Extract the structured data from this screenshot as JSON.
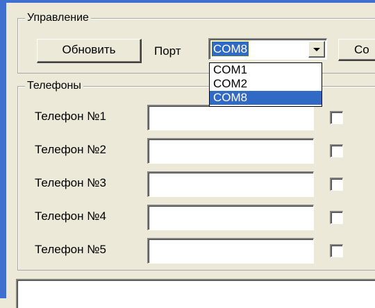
{
  "control_group": {
    "legend": "Управление",
    "refresh_button": "Обновить",
    "port_label": "Порт",
    "port_value": "COM8",
    "connect_button_partial": "Co",
    "port_options": [
      "COM1",
      "COM2",
      "COM8"
    ],
    "selected_option": "COM8"
  },
  "phones_group": {
    "legend": "Телефоны",
    "rows": [
      {
        "label": "Телефон №1",
        "value": ""
      },
      {
        "label": "Телефон №2",
        "value": ""
      },
      {
        "label": "Телефон №3",
        "value": ""
      },
      {
        "label": "Телефон №4",
        "value": ""
      },
      {
        "label": "Телефон №5",
        "value": ""
      }
    ]
  },
  "colors": {
    "window_blue": "#3f6fcf",
    "selection_blue": "#316ac5",
    "face": "#ece9d8"
  }
}
